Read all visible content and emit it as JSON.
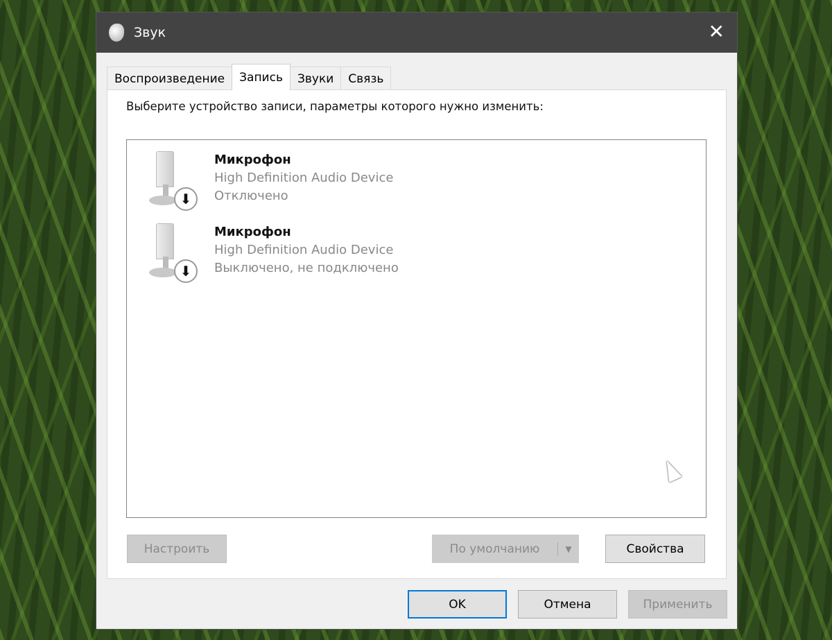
{
  "window": {
    "title": "Звук",
    "close_label": "✕"
  },
  "tabs": [
    "Воспроизведение",
    "Запись",
    "Звуки",
    "Связь"
  ],
  "active_tab": "Запись",
  "prompt": "Выберите устройство записи, параметры которого нужно изменить:",
  "devices": [
    {
      "name": "Микрофон",
      "driver": "High Definition Audio Device",
      "status": "Отключено",
      "icon": "microphone-icon"
    },
    {
      "name": "Микрофон",
      "driver": "High Definition Audio Device",
      "status": "Выключено, не подключено",
      "icon": "microphone-icon"
    }
  ],
  "buttons": {
    "configure": "Настроить",
    "default": "По умолчанию",
    "default_arrow": "▼",
    "properties": "Свойства",
    "ok": "OK",
    "cancel": "Отмена",
    "apply": "Применить"
  },
  "badge_glyph": "🡇"
}
